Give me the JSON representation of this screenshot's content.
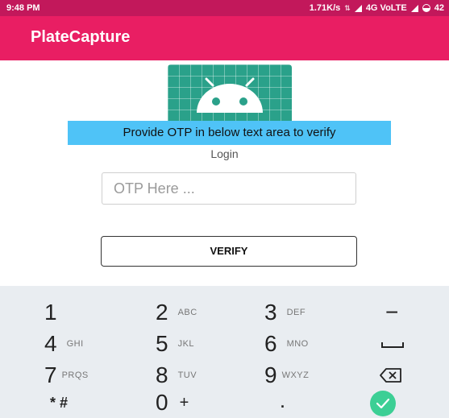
{
  "status_bar": {
    "time": "9:48 PM",
    "speed": "1.71K/s",
    "network": "4G VoLTE",
    "battery": "42"
  },
  "app_bar": {
    "title": "PlateCapture"
  },
  "toast": {
    "text": "Provide OTP in below text area to verify"
  },
  "login": {
    "label": "Login"
  },
  "otp": {
    "placeholder": "OTP Here ...",
    "value": ""
  },
  "verify": {
    "label": "VERIFY"
  },
  "keypad": {
    "keys": [
      {
        "num": "1",
        "letters": ""
      },
      {
        "num": "2",
        "letters": "ABC"
      },
      {
        "num": "3",
        "letters": "DEF"
      },
      {
        "num": "4",
        "letters": "GHI"
      },
      {
        "num": "5",
        "letters": "JKL"
      },
      {
        "num": "6",
        "letters": "MNO"
      },
      {
        "num": "7",
        "letters": "PRQS"
      },
      {
        "num": "8",
        "letters": "TUV"
      },
      {
        "num": "9",
        "letters": "WXYZ"
      },
      {
        "num": "0",
        "letters": "+"
      }
    ],
    "star_hash": "* #",
    "minus": "−",
    "period": "."
  },
  "colors": {
    "status_bar": "#c2185b",
    "app_bar": "#e91e63",
    "logo": "#2aa18a",
    "toast": "#4fc3f7",
    "keypad_bg": "#e9edf1",
    "done": "#3ccf95"
  }
}
